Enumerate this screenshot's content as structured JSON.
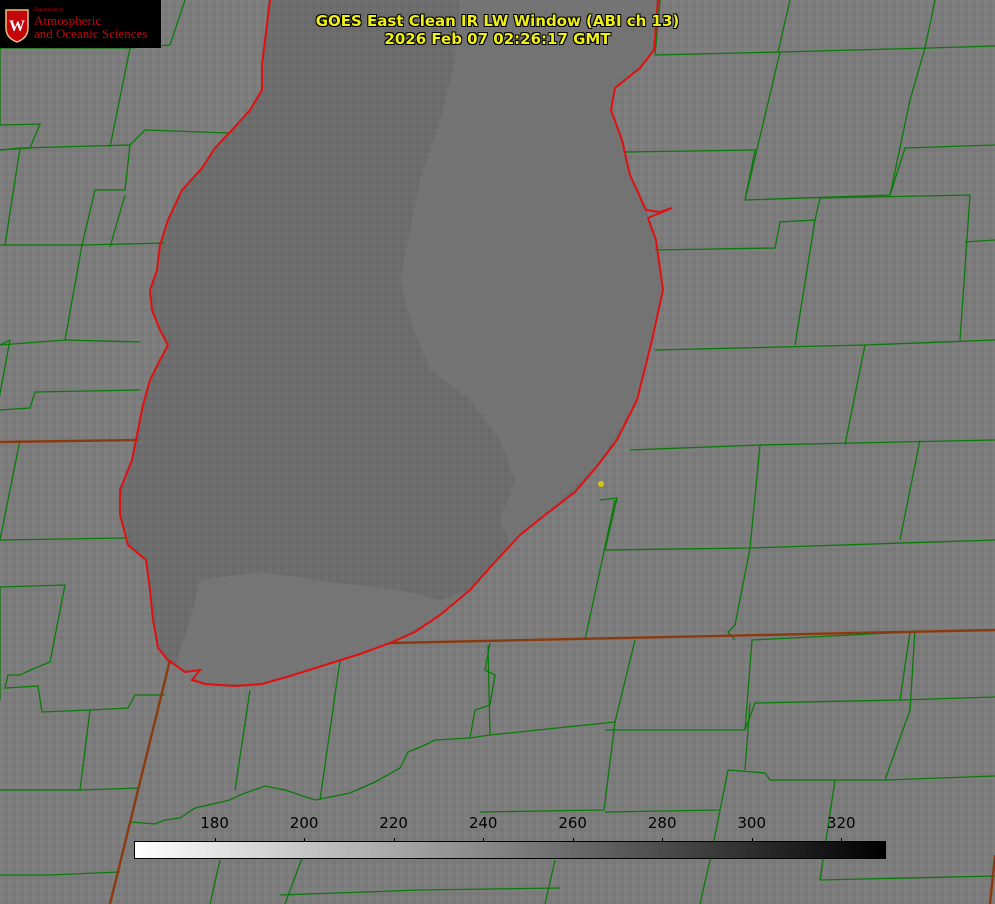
{
  "logo": {
    "department_line": "Department of",
    "line1": "Atmospheric",
    "line2": "and Oceanic Sciences",
    "crest_letter": "W",
    "crest_color": "#c5050c"
  },
  "title": {
    "line1": "GOES East Clean IR LW Window (ABI ch 13)",
    "line2": "2026 Feb 07 02:26:17 GMT",
    "color": "#f0f016"
  },
  "colorbar": {
    "ticks": [
      "180",
      "200",
      "220",
      "240",
      "260",
      "280",
      "300",
      "320"
    ],
    "tick_values": [
      180,
      200,
      220,
      240,
      260,
      280,
      300,
      320
    ],
    "range": [
      162,
      330
    ],
    "gradient": [
      "#ffffff",
      "#000000"
    ]
  },
  "map": {
    "features": [
      "lake-outline",
      "county-borders",
      "state-borders",
      "location-marker"
    ],
    "colors": {
      "background": "#7c7c7c",
      "lake": "#6b6b6b",
      "county_border": "#0a7a0a",
      "state_border": "#8b3a0f",
      "coastline": "#e01010",
      "marker": "#d4c417"
    }
  }
}
